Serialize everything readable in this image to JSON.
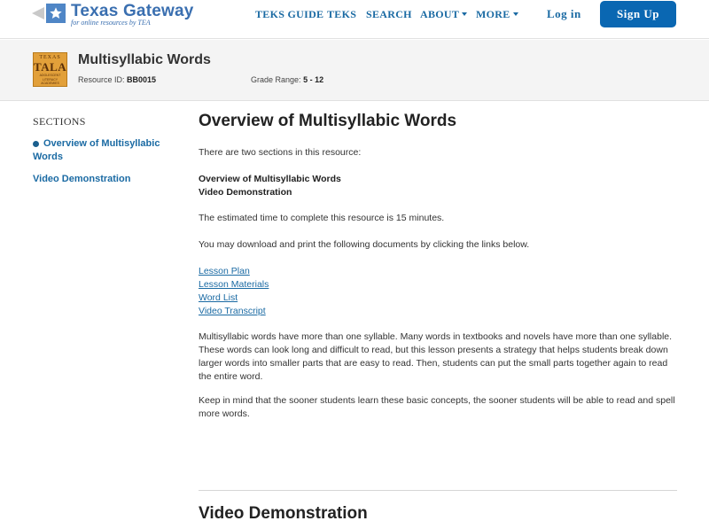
{
  "header": {
    "logo_title": "Texas Gateway",
    "logo_subtitle": "for online resources by TEA",
    "nav": {
      "teks_guide": "TEKS GUIDE",
      "teks": "TEKS",
      "search": "SEARCH",
      "about": "ABOUT",
      "more": "MORE"
    },
    "login": "Log in",
    "signup": "Sign Up"
  },
  "banner": {
    "logo_line1": "TEXAS",
    "logo_line2": "TALA",
    "logo_line3a": "ADOLESCENT",
    "logo_line3b": "LITERACY",
    "logo_line3c": "ACADEMIES",
    "title": "Multisyllabic Words",
    "resource_id_label": "Resource ID:",
    "resource_id": "BB0015",
    "grade_range_label": "Grade Range:",
    "grade_range": "5 - 12"
  },
  "sidebar": {
    "heading": "SECTIONS",
    "items": [
      {
        "label": "Overview of Multisyllabic Words",
        "active": true
      },
      {
        "label": "Video Demonstration",
        "active": false
      }
    ]
  },
  "main": {
    "title": "Overview of Multisyllabic Words",
    "intro": "There are two sections in this resource:",
    "section_list": [
      "Overview of Multisyllabic Words",
      "Video Demonstration"
    ],
    "time_note": "The estimated time to complete this resource is 15 minutes.",
    "download_note": "You may download and print the following documents by clicking the links below.",
    "documents": [
      "Lesson Plan",
      "Lesson Materials",
      "Word List",
      "Video Transcript"
    ],
    "para1": "Multisyllabic words have more than one syllable. Many words in textbooks and novels have more than one syllable. These words can look long and difficult to read, but this lesson presents a strategy that helps students break down larger words into smaller parts that are easy to read. Then, students can put the small parts together again to read the entire word.",
    "para2": "Keep in mind that the sooner students learn these basic concepts, the sooner students will be able to read and spell more words.",
    "next_section_title": "Video Demonstration"
  },
  "colors": {
    "link": "#1a6aa3",
    "signup_bg": "#0a67b2",
    "banner_bg": "#f4f4f4",
    "logo_blue": "#4f86c6",
    "tala_orange": "#e2a03a"
  }
}
